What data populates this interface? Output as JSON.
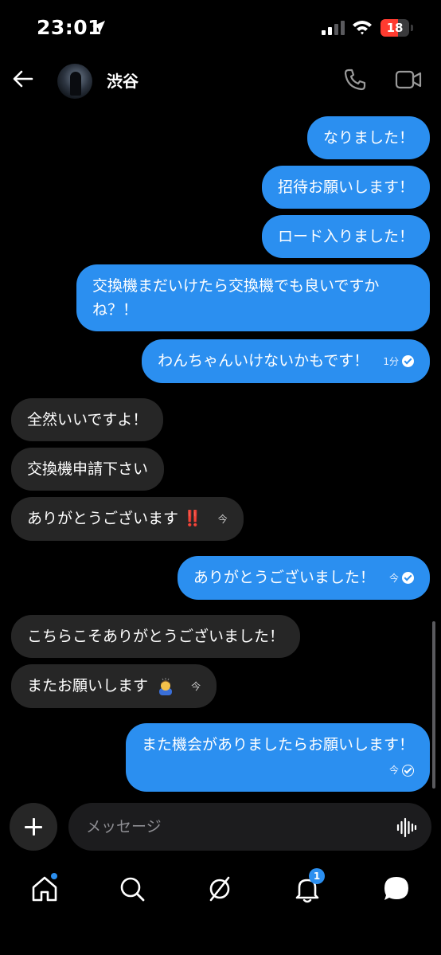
{
  "status_bar": {
    "time": "23:01",
    "battery": "18",
    "battery_color": "#ff3b30",
    "icons": [
      "location-arrow-icon",
      "signal-icon",
      "wifi-icon",
      "battery-icon"
    ]
  },
  "header": {
    "contact_name": "渋谷",
    "icons": [
      "back-arrow-icon",
      "phone-icon",
      "video-icon"
    ]
  },
  "messages": [
    {
      "dir": "out",
      "text": "なりました！"
    },
    {
      "dir": "out",
      "text": "招待お願いします！"
    },
    {
      "dir": "out",
      "text": "ロード入りました！"
    },
    {
      "dir": "out",
      "text": "交換機まだいけたら交換機でも良いですかね？！"
    },
    {
      "dir": "out",
      "text": "わんちゃんいけないかもです！",
      "time": "1分",
      "status": "read"
    },
    {
      "dir": "in",
      "text": "全然いいですよ！"
    },
    {
      "dir": "in",
      "text": "交換機申請下さい"
    },
    {
      "dir": "in",
      "text": "ありがとうございます",
      "emoji": "‼️",
      "time": "今"
    },
    {
      "dir": "out",
      "text": "ありがとうございました！",
      "time": "今",
      "status": "read"
    },
    {
      "dir": "in",
      "text": "こちらこそありがとうございました！"
    },
    {
      "dir": "in",
      "text": "またお願いします",
      "emoji": "bowing-person",
      "time": "今"
    },
    {
      "dir": "out",
      "text": "また機会がありましたらお願いします！",
      "time": "今",
      "status": "sent"
    }
  ],
  "composer": {
    "placeholder": "メッセージ",
    "icons": [
      "plus-icon",
      "voice-waveform-icon"
    ]
  },
  "bottom_nav": {
    "items": [
      {
        "name": "home",
        "icon": "home-icon",
        "badge_dot": true
      },
      {
        "name": "search",
        "icon": "search-icon"
      },
      {
        "name": "explore",
        "icon": "compass-icon"
      },
      {
        "name": "notifications",
        "icon": "bell-icon",
        "badge": "1"
      },
      {
        "name": "messages",
        "icon": "chat-bubble-icon"
      }
    ]
  },
  "colors": {
    "background": "#000000",
    "outgoing_bubble": "#2b8ff0",
    "incoming_bubble": "#262626",
    "accent": "#2b8ff0"
  }
}
